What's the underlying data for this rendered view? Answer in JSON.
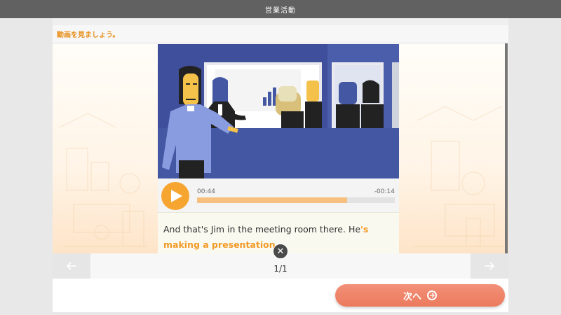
{
  "app": {
    "title": "営業活動"
  },
  "instruction": "動画を見ましょう。",
  "player": {
    "elapsed": "00:44",
    "remaining": "-00:14",
    "progress_fraction": 0.76
  },
  "subtitle": {
    "plain": "And that's Jim in the meeting room there. He",
    "highlight": "'s making a presentation"
  },
  "pager": {
    "page_text": "1/1"
  },
  "next_button": {
    "label": "次へ"
  },
  "colors": {
    "accent": "#f7a531",
    "next": "#ec7a5d",
    "highlight": "#f29a26",
    "video_bg": "#4457a3"
  },
  "icons": {
    "play": "play-icon",
    "close": "close-icon",
    "prev": "arrow-left-icon",
    "next": "arrow-right-icon",
    "next_circle": "circle-arrow-right-icon"
  }
}
